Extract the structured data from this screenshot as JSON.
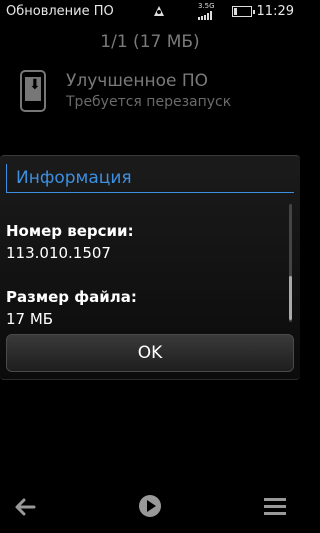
{
  "status_bar": {
    "title": "Обновление ПО",
    "network": "3.5G",
    "time": "11:29",
    "battery_level": 0.15
  },
  "background": {
    "package_count": "1/1 (17 МБ)",
    "item": {
      "icon": "phone-download-icon",
      "name": "Улучшенное ПО",
      "subtitle": "Требуется перезапуск"
    }
  },
  "dialog": {
    "title": "Информация",
    "fields": [
      {
        "label": "Номер версии:",
        "value": "113.010.1507"
      },
      {
        "label": "Размер файла:",
        "value": "17 МБ"
      }
    ],
    "ok_label": "OK"
  },
  "toolbar": {
    "back_icon": "back-arrow-icon",
    "play_icon": "play-icon",
    "menu_icon": "menu-icon"
  },
  "colors": {
    "accent": "#3d8fe0",
    "background": "#000000",
    "dim_text": "#7a7a7a"
  }
}
